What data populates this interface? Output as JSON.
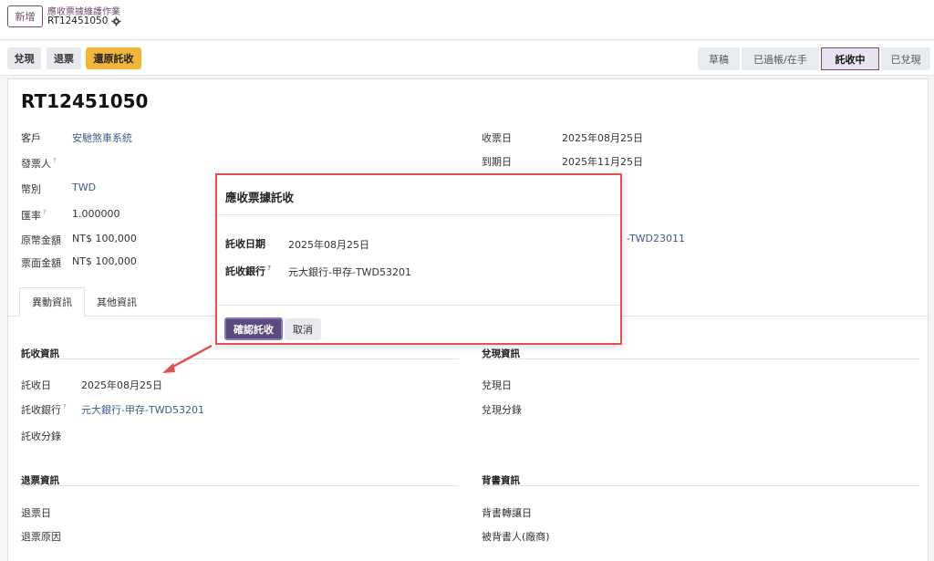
{
  "topbar": {
    "new_label": "新增",
    "breadcrumb_parent": "應收票據維護作業",
    "breadcrumb_current": "RT12451050"
  },
  "actions": {
    "cash": "兌現",
    "return": "退票",
    "revert": "還原託收"
  },
  "status_stages": [
    "草稿",
    "已過帳/在手",
    "託收中",
    "已兌現"
  ],
  "status_active": "託收中",
  "record": {
    "title": "RT12451050",
    "left_fields": [
      {
        "label": "客戶",
        "value": "安馳煞車系統",
        "help": false
      },
      {
        "label": "發票人",
        "value": "",
        "help": true
      },
      {
        "label": "幣別",
        "value": "TWD",
        "help": false
      },
      {
        "label": "匯率",
        "value": "1.000000",
        "help": true
      },
      {
        "label": "原幣金額",
        "value": "NT$ 100,000",
        "help": false
      },
      {
        "label": "票面金額",
        "value": "NT$ 100,000",
        "help": false
      }
    ],
    "right_fields": [
      {
        "label": "收票日",
        "value": "2025年08月25日"
      },
      {
        "label": "到期日",
        "value": "2025年11月25日"
      }
    ],
    "partial_bank_value": "-TWD23011"
  },
  "tabs": [
    "異動資訊",
    "其他資訊"
  ],
  "sections": {
    "collection": {
      "title": "託收資訊",
      "date_label": "託收日",
      "date_value": "2025年08月25日",
      "bank_label": "託收銀行",
      "bank_value": "元大銀行-甲存-TWD53201",
      "entry_label": "託收分錄"
    },
    "cashing": {
      "title": "兌現資訊",
      "date_label": "兌現日",
      "entry_label": "兌現分錄"
    },
    "bounce": {
      "title": "退票資訊",
      "date_label": "退票日",
      "reason_label": "退票原因"
    },
    "endorse": {
      "title": "背書資訊",
      "date_label": "背書轉讓日",
      "person_label": "被背書人(廠商)"
    }
  },
  "dialog": {
    "title": "應收票據託收",
    "date_label": "託收日期",
    "date_value": "2025年08月25日",
    "bank_label": "託收銀行",
    "bank_value": "元大銀行-甲存-TWD53201",
    "confirm_label": "確認託收",
    "cancel_label": "取消"
  },
  "colors": {
    "brand": "#714b67",
    "accent_orange": "#f3b43a",
    "highlight_red": "#e05252",
    "confirm_purple": "#5c4a7d"
  }
}
